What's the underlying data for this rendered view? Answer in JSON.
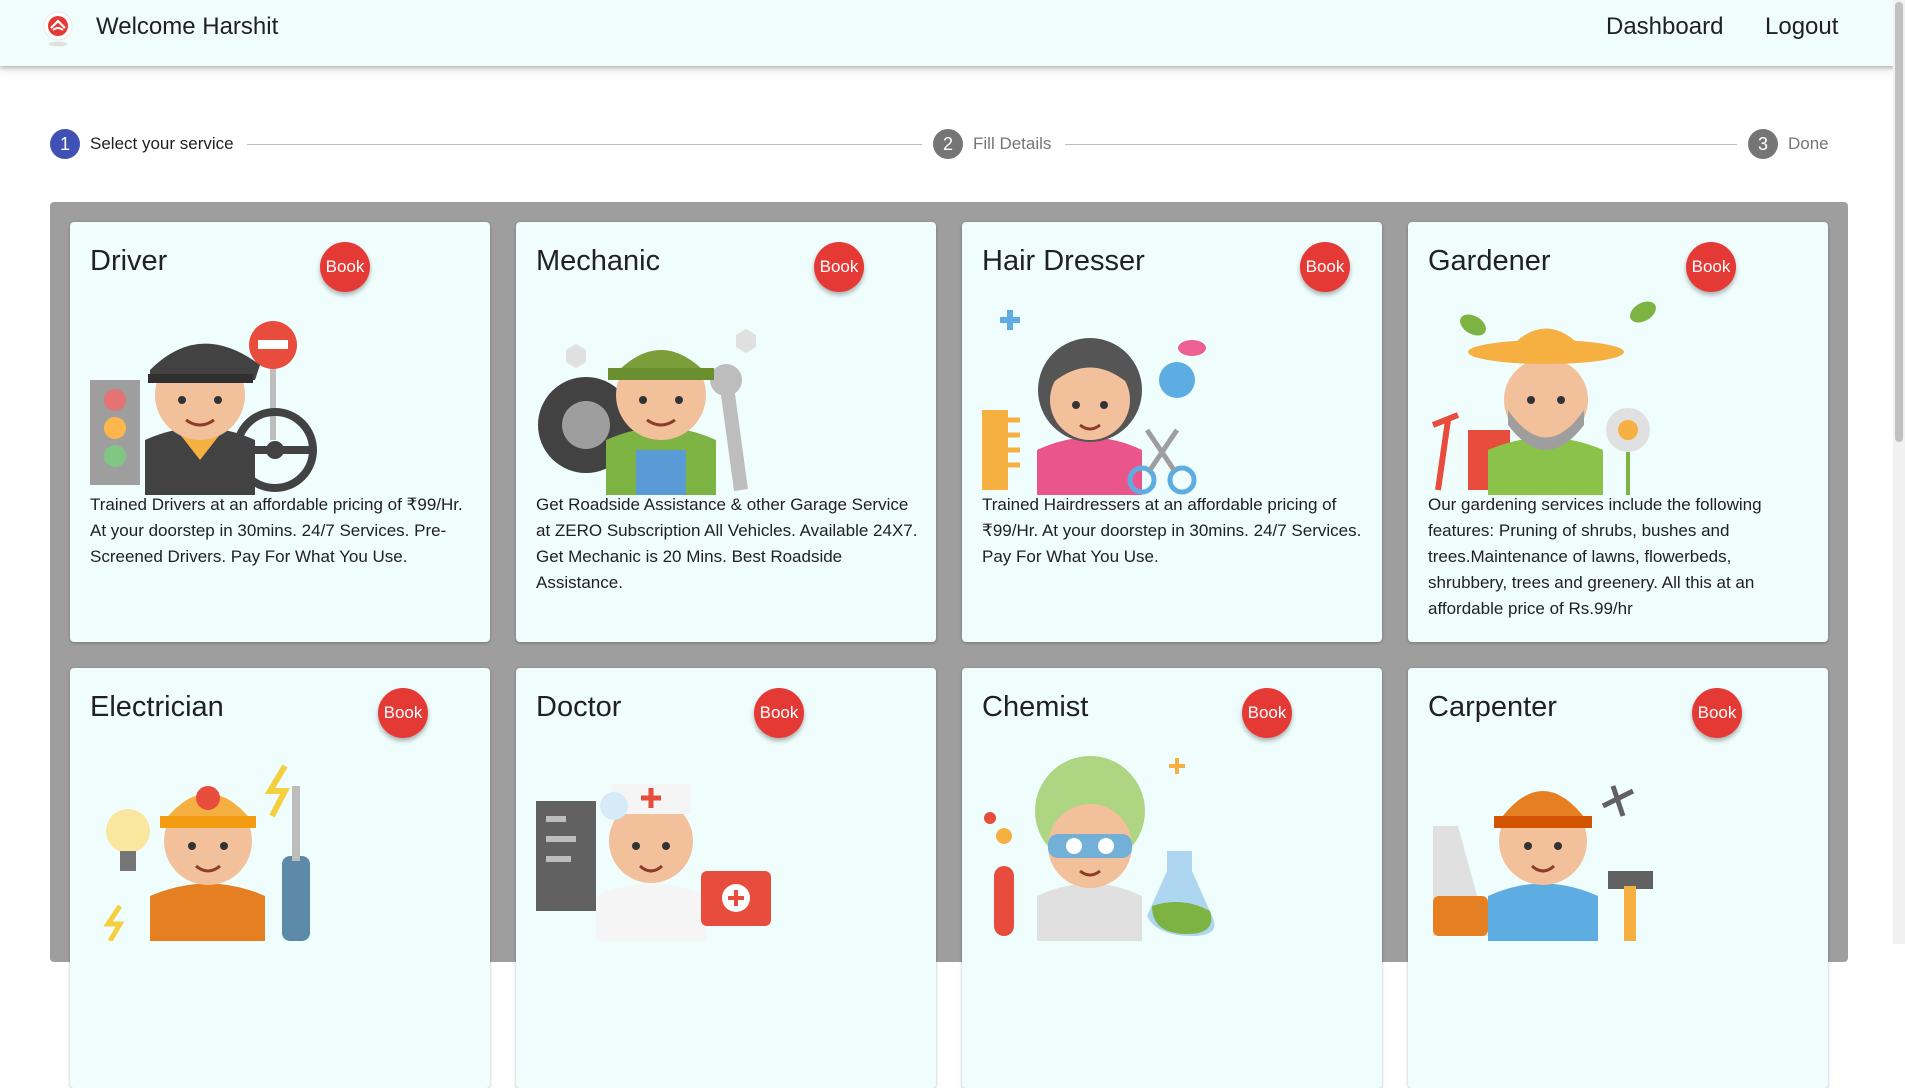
{
  "header": {
    "title": "Welcome Harshit",
    "nav": {
      "dashboard": "Dashboard",
      "logout": "Logout"
    }
  },
  "stepper": {
    "steps": [
      {
        "number": "1",
        "label": "Select your service",
        "state": "active"
      },
      {
        "number": "2",
        "label": "Fill Details",
        "state": "inactive"
      },
      {
        "number": "3",
        "label": "Done",
        "state": "inactive"
      }
    ]
  },
  "services": [
    {
      "title": "Driver",
      "book_label": "Book",
      "icon": "driver-icon",
      "description": "Trained Drivers at an affordable pricing of ₹99/Hr. At your doorstep in 30mins. 24/7 Services. Pre-Screened Drivers. Pay For What You Use."
    },
    {
      "title": "Mechanic",
      "book_label": "Book",
      "icon": "mechanic-icon",
      "description": "Get Roadside Assistance & other Garage Service at ZERO Subscription All Vehicles. Available 24X7. Get Mechanic is 20 Mins. Best Roadside Assistance."
    },
    {
      "title": "Hair Dresser",
      "book_label": "Book",
      "icon": "hair-dresser-icon",
      "description": "Trained Hairdressers at an affordable pricing of ₹99/Hr. At your doorstep in 30mins. 24/7 Services. Pay For What You Use."
    },
    {
      "title": "Gardener",
      "book_label": "Book",
      "icon": "gardener-icon",
      "description": "Our gardening services include the following features: Pruning of shrubs, bushes and trees.Maintenance of lawns, flowerbeds, shrubbery, trees and greenery. All this at an affordable price of Rs.99/hr"
    },
    {
      "title": "Electrician",
      "book_label": "Book",
      "icon": "electrician-icon",
      "description": ""
    },
    {
      "title": "Doctor",
      "book_label": "Book",
      "icon": "doctor-icon",
      "description": ""
    },
    {
      "title": "Chemist",
      "book_label": "Book",
      "icon": "chemist-icon",
      "description": ""
    },
    {
      "title": "Carpenter",
      "book_label": "Book",
      "icon": "carpenter-icon",
      "description": ""
    }
  ],
  "colors": {
    "appbar_bg": "#f0fdfd",
    "card_bg": "#f0fdfd",
    "grid_bg": "#9e9e9e",
    "book_button": "#e53935",
    "step_active": "#3f51b5",
    "step_inactive": "#757575"
  }
}
